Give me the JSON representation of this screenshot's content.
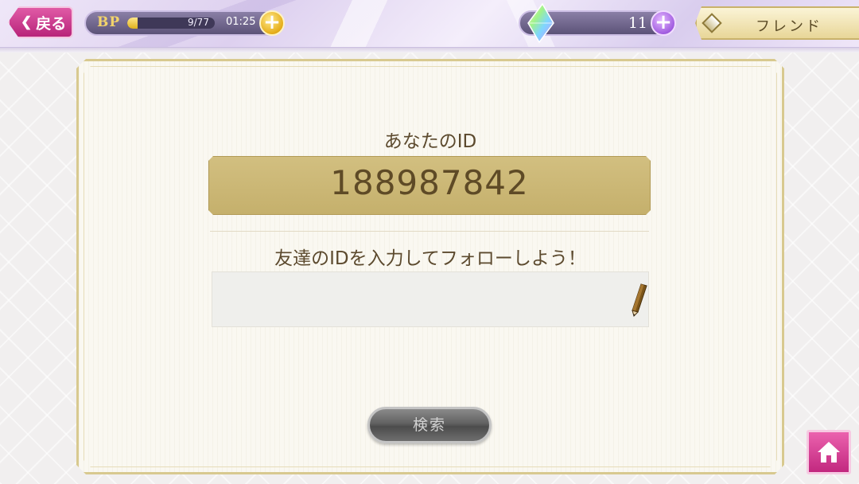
{
  "header": {
    "back_label": "戻る",
    "bp": {
      "label": "BP",
      "count": "9/77",
      "current": 9,
      "max": 77,
      "timer": "01:25"
    },
    "gems": {
      "count": "11"
    },
    "page_tab": "フレンド"
  },
  "main": {
    "your_id_label": "あなたのID",
    "your_id_value": "188987842",
    "prompt": "友達のIDを入力してフォローしよう！",
    "input_value": "",
    "input_placeholder": "",
    "search_label": "検索"
  },
  "icons": {
    "back": "chevron-left-icon",
    "bp_add": "plus-icon",
    "gem": "gem-icon",
    "gem_add": "plus-icon",
    "tab": "diamond-icon",
    "pencil": "pencil-icon",
    "home": "home-icon"
  },
  "colors": {
    "accent_pink": "#d13f93",
    "gold": "#c9b36f",
    "text_brown": "#5c4a2e",
    "button_disabled": "#616161"
  }
}
